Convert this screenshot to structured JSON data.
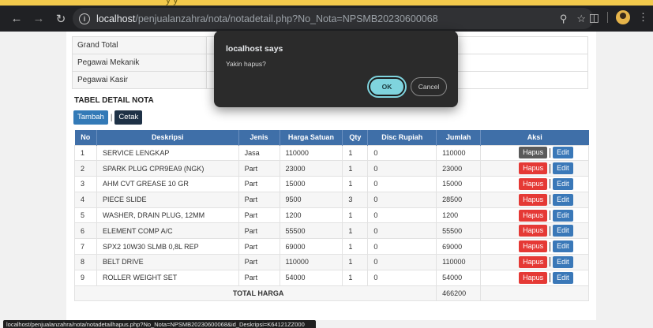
{
  "top_strip_text": "y y",
  "browser": {
    "url_host": "localhost",
    "url_path": "/penjualanzahra/nota/notadetail.php?No_Nota=NPSMB20230600068"
  },
  "summary": [
    {
      "label": "Grand Total",
      "value": ""
    },
    {
      "label": "Pegawai Mekanik",
      "value": ""
    },
    {
      "label": "Pegawai Kasir",
      "value": ""
    }
  ],
  "section_title": "TABEL DETAIL NOTA",
  "buttons": {
    "tambah": "Tambah",
    "separator": "|",
    "cetak": "Cetak"
  },
  "table": {
    "headers": [
      "No",
      "Deskripsi",
      "Jenis",
      "Harga Satuan",
      "Qty",
      "Disc Rupiah",
      "Jumlah",
      "Aksi"
    ],
    "rows": [
      {
        "no": "1",
        "deskripsi": "SERVICE LENGKAP",
        "jenis": "Jasa",
        "harga": "110000",
        "qty": "1",
        "disc": "0",
        "jumlah": "110000"
      },
      {
        "no": "2",
        "deskripsi": "SPARK PLUG CPR9EA9 (NGK)",
        "jenis": "Part",
        "harga": "23000",
        "qty": "1",
        "disc": "0",
        "jumlah": "23000"
      },
      {
        "no": "3",
        "deskripsi": "AHM CVT GREASE 10 GR",
        "jenis": "Part",
        "harga": "15000",
        "qty": "1",
        "disc": "0",
        "jumlah": "15000"
      },
      {
        "no": "4",
        "deskripsi": "PIECE SLIDE",
        "jenis": "Part",
        "harga": "9500",
        "qty": "3",
        "disc": "0",
        "jumlah": "28500"
      },
      {
        "no": "5",
        "deskripsi": "WASHER, DRAIN PLUG, 12MM",
        "jenis": "Part",
        "harga": "1200",
        "qty": "1",
        "disc": "0",
        "jumlah": "1200"
      },
      {
        "no": "6",
        "deskripsi": "ELEMENT COMP A/C",
        "jenis": "Part",
        "harga": "55500",
        "qty": "1",
        "disc": "0",
        "jumlah": "55500"
      },
      {
        "no": "7",
        "deskripsi": "SPX2 10W30 SLMB 0,8L REP",
        "jenis": "Part",
        "harga": "69000",
        "qty": "1",
        "disc": "0",
        "jumlah": "69000"
      },
      {
        "no": "8",
        "deskripsi": "BELT DRIVE",
        "jenis": "Part",
        "harga": "110000",
        "qty": "1",
        "disc": "0",
        "jumlah": "110000"
      },
      {
        "no": "9",
        "deskripsi": "ROLLER WEIGHT SET",
        "jenis": "Part",
        "harga": "54000",
        "qty": "1",
        "disc": "0",
        "jumlah": "54000"
      }
    ],
    "action_hapus": "Hapus",
    "action_separator": "|",
    "action_edit": "Edit",
    "total_label": "TOTAL HARGA",
    "total_value": "466200"
  },
  "status_link": "localhost/penjualanzahra/nota/notadetailhapus.php?No_Nota=NPSMB20230600068&id_Deskripsi=K64121ZZ000",
  "dialog": {
    "title": "localhost says",
    "message": "Yakin hapus?",
    "ok": "OK",
    "cancel": "Cancel"
  },
  "colors": {
    "header_blue": "#3f6fa8",
    "hapus_red": "#e53935",
    "edit_blue": "#3a78b8",
    "ok_cyan": "#7fd4de"
  },
  "icons": [
    "back-arrow-icon",
    "forward-arrow-icon",
    "reload-icon",
    "site-info-icon",
    "zoom-icon",
    "bookmark-star-icon",
    "extensions-icon",
    "profile-avatar-icon"
  ]
}
